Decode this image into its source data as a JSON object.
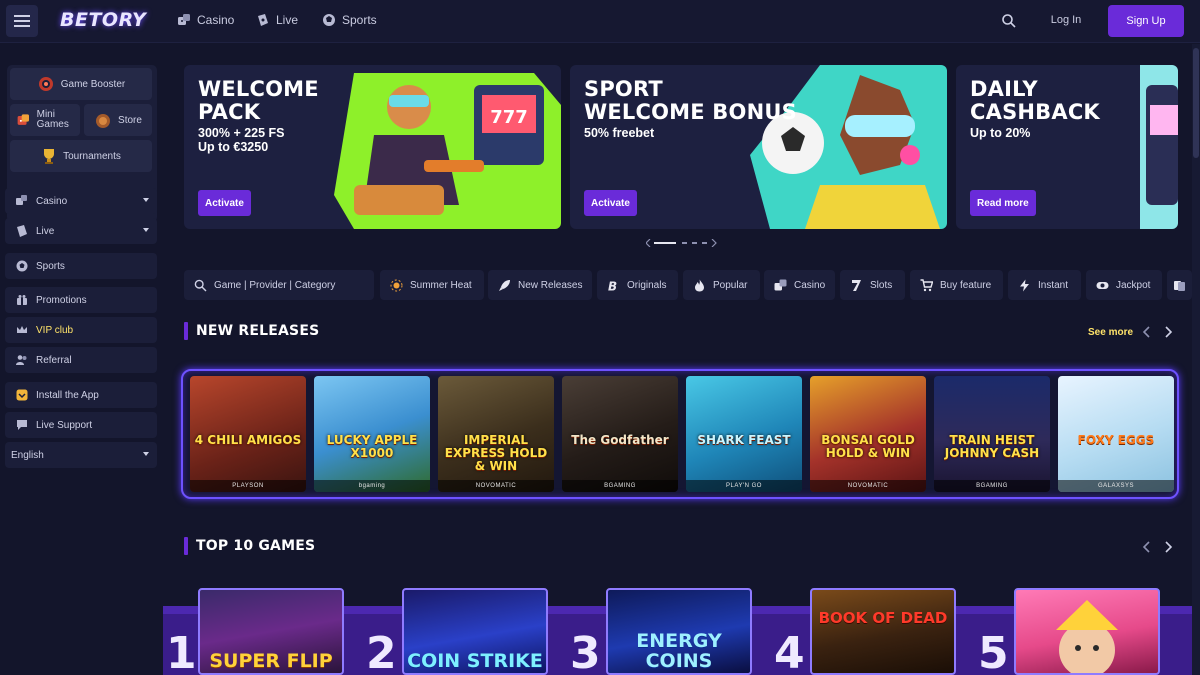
{
  "topbar": {
    "logo": "BETORY",
    "nav": [
      {
        "label": "Casino",
        "icon": "dice-icon"
      },
      {
        "label": "Live",
        "icon": "live-cards-icon"
      },
      {
        "label": "Sports",
        "icon": "ball-icon"
      }
    ],
    "login_label": "Log In",
    "signup_label": "Sign Up"
  },
  "sidebar": {
    "game_booster": "Game Booster",
    "mini_games": "Mini Games",
    "store": "Store",
    "tournaments": "Tournaments",
    "items": [
      {
        "label": "Casino",
        "icon": "dice-icon",
        "dropdown": true
      },
      {
        "label": "Live",
        "icon": "live-cards-icon",
        "dropdown": true
      },
      {
        "label": "Sports",
        "icon": "ball-icon"
      },
      {
        "label": "Promotions",
        "icon": "gift-icon"
      },
      {
        "label": "VIP club",
        "icon": "crown-icon",
        "color": "#ffe36a"
      },
      {
        "label": "Referral",
        "icon": "people-icon"
      },
      {
        "label": "Install the App",
        "icon": "app-icon"
      },
      {
        "label": "Live Support",
        "icon": "chat-icon"
      }
    ],
    "language": "English"
  },
  "banners": [
    {
      "title_line1": "WELCOME",
      "title_line2": "PACK",
      "sub_line1": "300% + 225 FS",
      "sub_line2": "Up to €3250",
      "cta": "Activate"
    },
    {
      "title_line1": "SPORT",
      "title_line2": "WELCOME BONUS",
      "sub_line1": "50% freebet",
      "cta": "Activate"
    },
    {
      "title_line1": "DAILY",
      "title_line2": "CASHBACK",
      "sub_line1": "Up to 20%",
      "cta": "Read more"
    }
  ],
  "categories": {
    "search_placeholder": "Game | Provider | Category",
    "items": [
      "Summer Heat",
      "New Releases",
      "Originals",
      "Popular",
      "Casino",
      "Slots",
      "Buy feature",
      "Instant",
      "Jackpot"
    ]
  },
  "new_releases": {
    "title": "NEW RELEASES",
    "see_more": "See more",
    "games": [
      {
        "name": "4 CHILI AMIGOS",
        "provider": "PLAYSON"
      },
      {
        "name": "LUCKY APPLE X1000",
        "provider": "bgaming"
      },
      {
        "name": "IMPERIAL EXPRESS HOLD & WIN",
        "provider": "NOVOMATIC"
      },
      {
        "name": "The Godfather",
        "provider": "BGAMING"
      },
      {
        "name": "SHARK FEAST",
        "provider": "PLAY'N GO"
      },
      {
        "name": "BONSAI GOLD HOLD & WIN",
        "provider": "NOVOMATIC"
      },
      {
        "name": "TRAIN HEIST JOHNNY CASH",
        "provider": "BGAMING"
      },
      {
        "name": "FOXY EGGS",
        "provider": "GALAXSYS"
      }
    ]
  },
  "top10": {
    "title": "TOP 10 GAMES",
    "games": [
      {
        "rank": "1",
        "name": "SUPER FLIP"
      },
      {
        "rank": "2",
        "name": "COIN STRIKE"
      },
      {
        "rank": "3",
        "name": "ENERGY COINS"
      },
      {
        "rank": "4",
        "name": "BOOK OF DEAD"
      },
      {
        "rank": "5",
        "name": ""
      }
    ]
  },
  "colors": {
    "accent": "#6a2bd9",
    "vip": "#ffe36a",
    "bg": "#13152b"
  }
}
